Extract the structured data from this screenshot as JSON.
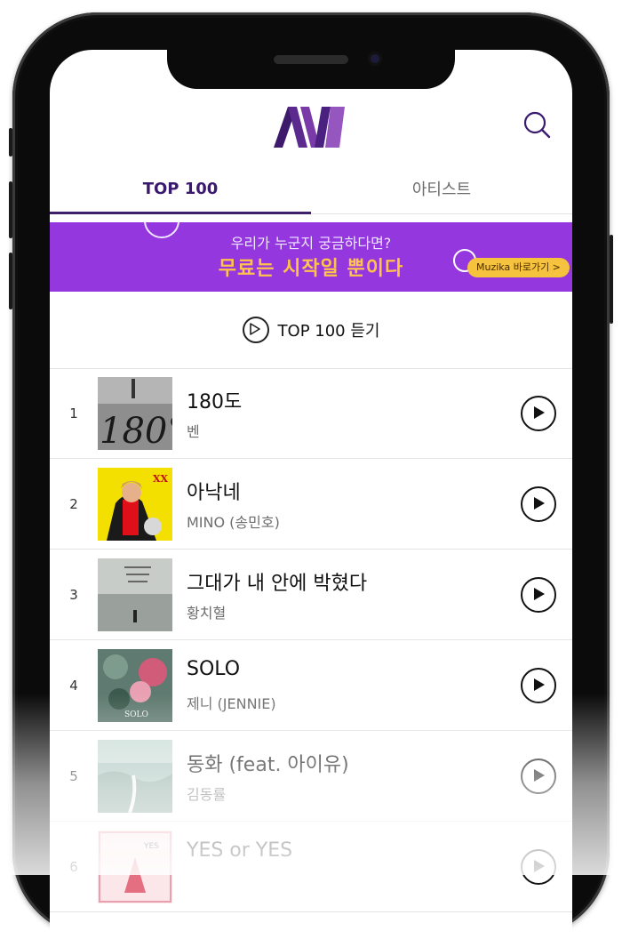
{
  "header": {
    "logo_alt": "MV",
    "search_icon": "search-icon"
  },
  "tabs": [
    {
      "label": "TOP 100",
      "active": true
    },
    {
      "label": "아티스트",
      "active": false
    }
  ],
  "banner": {
    "line1": "우리가 누군지 궁금하다면?",
    "line2": "무료는 시작일 뿐이다",
    "cta": "Muzika 바로가기 >"
  },
  "play_all": {
    "label": "TOP 100 듣기"
  },
  "songs": [
    {
      "rank": "1",
      "title": "180도",
      "artist": "벤"
    },
    {
      "rank": "2",
      "title": "아낙네",
      "artist": "MINO (송민호)"
    },
    {
      "rank": "3",
      "title": "그대가 내 안에 박혔다",
      "artist": "황치혈"
    },
    {
      "rank": "4",
      "title": "SOLO",
      "artist": "제니 (JENNIE)"
    },
    {
      "rank": "5",
      "title": "동화 (feat. 아이유)",
      "artist": "김동률"
    },
    {
      "rank": "6",
      "title": "YES or YES",
      "artist": ""
    }
  ],
  "colors": {
    "accent": "#3f1f6a",
    "banner": "#9437df",
    "banner_text": "#ffc24a",
    "pill": "#f6c33e"
  }
}
